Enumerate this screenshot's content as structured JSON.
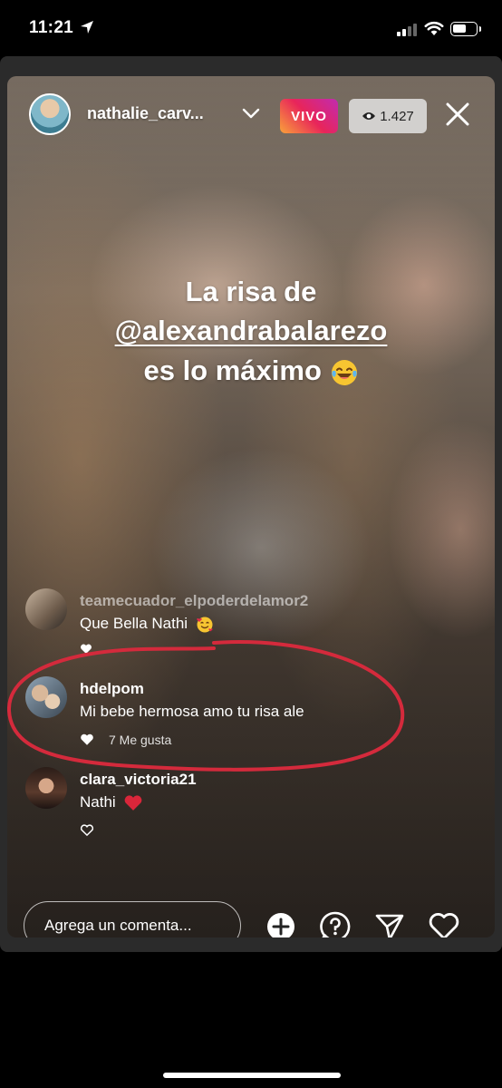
{
  "status_bar": {
    "time": "11:21"
  },
  "live": {
    "username": "nathalie_carv...",
    "live_badge": "VIVO",
    "viewer_count": "1.427",
    "caption": {
      "line1": "La risa de",
      "line2": "@alexandrabalarezo",
      "line3": "es lo máximo"
    },
    "comments": [
      {
        "username": "teamecuador_elpoderdelamor2",
        "text": "Que Bella Nathi"
      },
      {
        "username": "hdelpom",
        "text": "Mi bebe hermosa amo tu risa ale",
        "likes": "7 Me gusta"
      },
      {
        "username": "clara_victoria21",
        "text": "Nathi"
      }
    ],
    "comment_placeholder": "Agrega un comenta..."
  },
  "colors": {
    "live_badge_start": "#f9a23a",
    "live_badge_end": "#c12bb0",
    "annotation_circle": "#d42a3c",
    "heart_emoji": "#d9263a"
  }
}
